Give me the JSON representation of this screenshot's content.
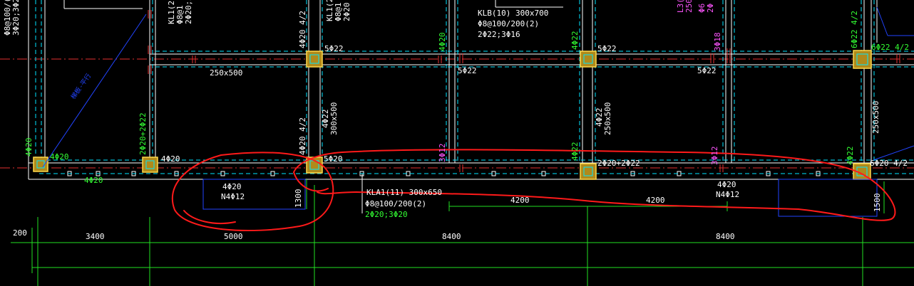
{
  "colors": {
    "background": "#000000",
    "beam_line": "#ffffff",
    "hidden_line": "#00e5ff",
    "axis_line": "#e53030",
    "column_fill": "#b08a1a",
    "column_edge": "#ffd84a",
    "dim_line": "#22e022",
    "dim_text": "#ffffff",
    "note_white": "#ffffff",
    "note_green": "#33ff33",
    "note_magenta": "#ff55ff",
    "note_blue": "#2244ff",
    "markup_red": "#ff1a1a"
  },
  "labels": {
    "top_left_1": "Φ8@100/(",
    "top_left_2": "3Φ20;3Φ2",
    "kl1_a": "KL1(2",
    "kl1_b": "Φ8@1",
    "kl1_c": "2Φ20;3",
    "kl1_2a": "KL1(2",
    "kl1_2b": "Φ8@1",
    "kl1_2c": "2Φ20",
    "klb_1": "KLB(10) 300x700",
    "klb_2": "Φ8@100/200(2)",
    "klb_3": "2Φ22;3Φ16",
    "l3_a": "L3(",
    "l3_b": "250",
    "l3_c": "Φ6",
    "l3_d": "2Φ",
    "diag_text": "梯板-平行",
    "beam_250x500": "250x500",
    "r_5022_a": "5Φ22",
    "r_5022_b": "5Φ22",
    "r_5022_c": "5Φ22",
    "r_5022_d": "5Φ22",
    "r_6022": "6Φ22 4/2",
    "v_4020_42_a": "4Φ20 4/2",
    "v_4020_42_b": "4Φ20 4/2",
    "v_4022_300": "4Φ22",
    "v_300x500": "300x500",
    "v_4022_250": "4Φ22",
    "v_250x500_a": "250x500",
    "v_250x500_b": "250x500",
    "v_6022_42": "6Φ22 4/2",
    "v_4022_g1": "4Φ22",
    "v_4022_g2": "4Φ22",
    "v_4022_g3": "4Φ22",
    "v_4022_g4": "4Φ22",
    "v_4020_g": "4Φ20",
    "v_2020_2022": "2Φ20+2Φ22",
    "v_4020_left": "4Φ20",
    "m_3012": "3Φ12",
    "m_3018": "3Φ18",
    "m_3012_b": "3Φ12",
    "m_3012_c": "3Φ12",
    "m_3020": "3Φ20",
    "c1_4020": "4Φ20",
    "c1_4020_g": "4Φ20",
    "c2_4020": "4Φ20",
    "c3_5020": "5Φ20",
    "c4_2020_2022": "2Φ20+2Φ22",
    "c5_6020_42": "6Φ20 4/2",
    "under_4020_a": "4Φ20",
    "under_n4_a": "N4Φ12",
    "under_4020_b": "4Φ20",
    "under_n4_b": "N4Φ12",
    "kla1_1": "KLA1(11) 300x650",
    "kla1_2": "Φ8@100/200(2)",
    "kla1_3": "2Φ20;3Φ20",
    "dim_1300": "1300",
    "dim_1500": "1500",
    "dim_4200_a": "4200",
    "dim_4200_b": "4200",
    "dim_200": "200",
    "dim_3400": "3400",
    "dim_5000": "5000",
    "dim_8400_a": "8400",
    "dim_8400_b": "8400"
  }
}
